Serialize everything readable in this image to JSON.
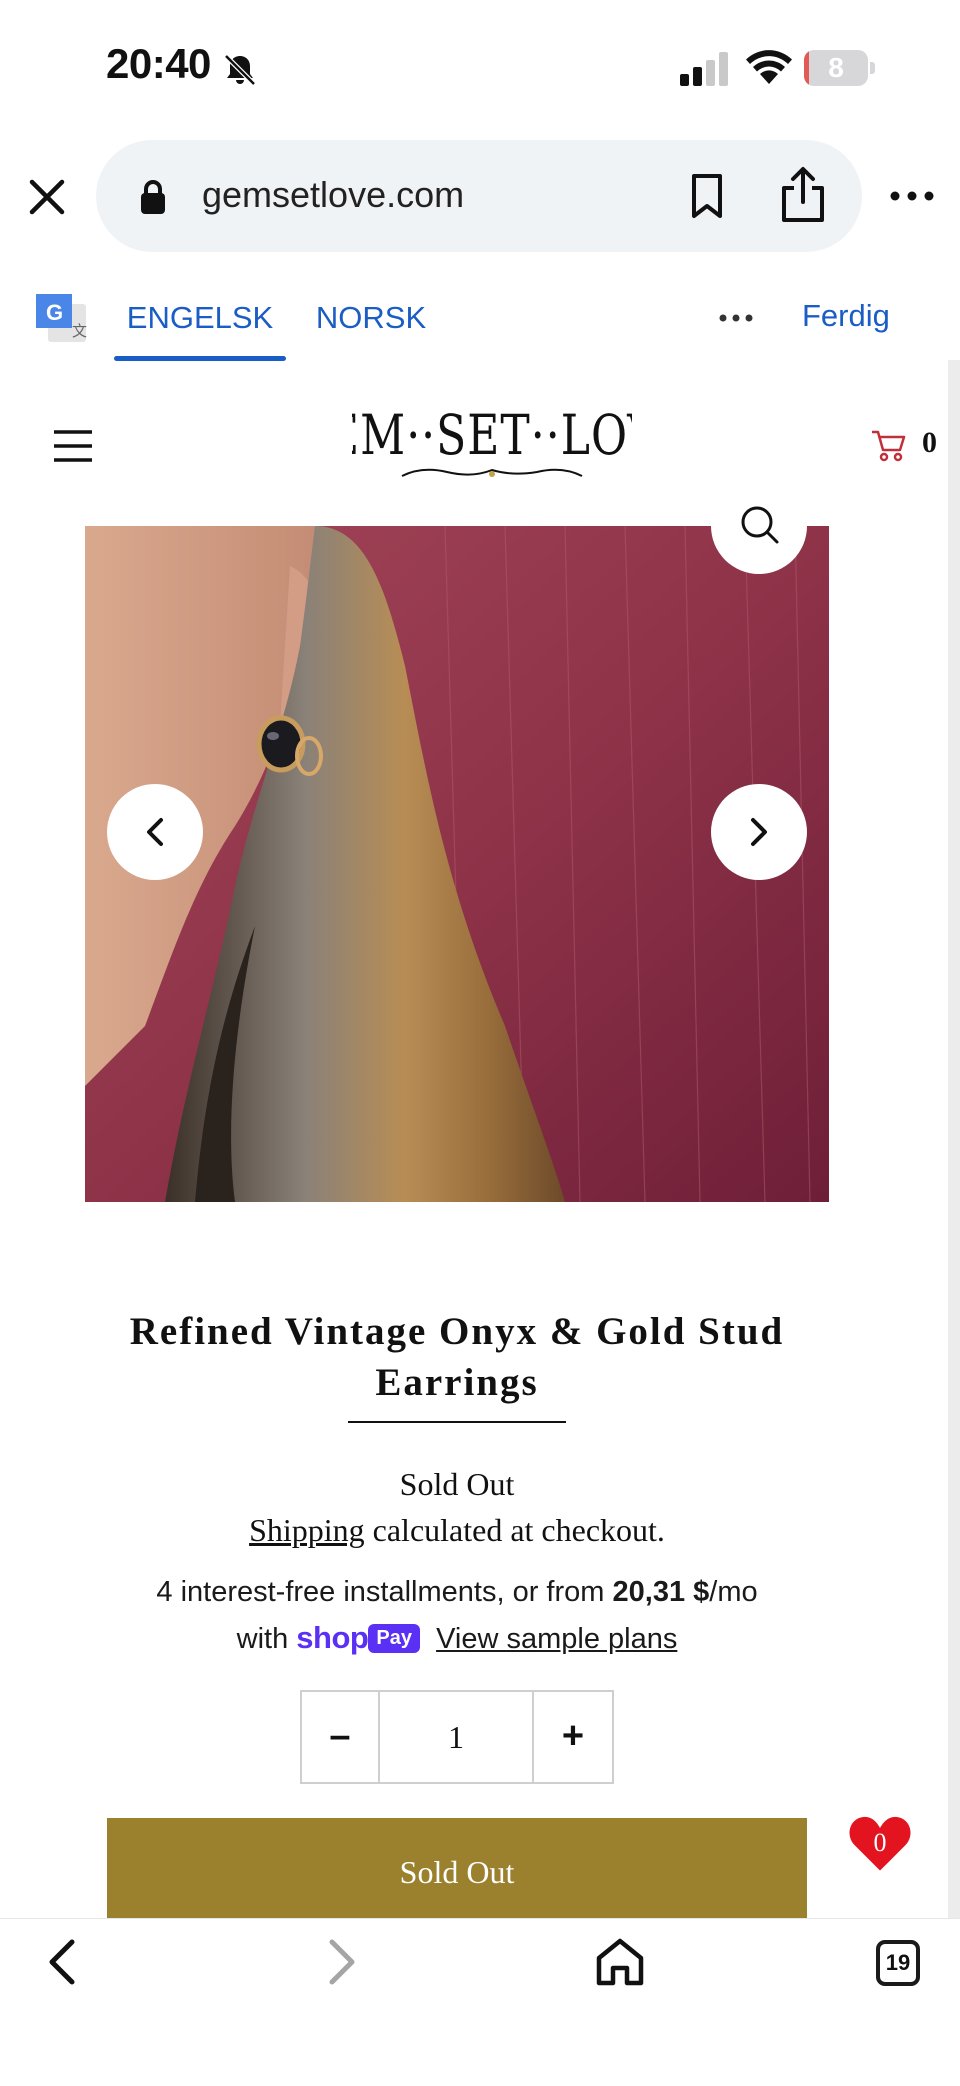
{
  "status_bar": {
    "time": "20:40",
    "battery_level": "8",
    "battery_percent": 8,
    "icons": [
      "bell-off-icon",
      "cellular-signal-icon",
      "wifi-icon",
      "battery-icon"
    ]
  },
  "browser": {
    "url": "gemsetlove.com",
    "icons": [
      "close-icon",
      "lock-icon",
      "bookmark-icon",
      "share-icon",
      "more-icon"
    ]
  },
  "translate_bar": {
    "tabs": [
      {
        "label": "ENGELSK",
        "active": true
      },
      {
        "label": "NORSK",
        "active": false
      }
    ],
    "done_label": "Ferdig",
    "accent": "#1a5dc4"
  },
  "site_header": {
    "logo_text": "GEM·SET·LOVE",
    "cart_count": "0"
  },
  "product": {
    "title": "Refined Vintage Onyx & Gold Stud Earrings",
    "availability": "Sold Out",
    "shipping_link": "Shipping",
    "shipping_rest": " calculated at checkout.",
    "installments_prefix": "4 interest-free installments, or from ",
    "installments_amount": "20,31 $",
    "installments_suffix": "/mo",
    "installments_with": "with",
    "shop_word": "shop",
    "pay_word": "Pay",
    "sample_plans_link": "View sample plans",
    "quantity": "1",
    "qty_minus": "–",
    "qty_plus": "+",
    "button_label": "Sold Out",
    "button_color": "#9b812e"
  },
  "wishlist": {
    "count": "0",
    "color": "#e3141f"
  },
  "bottom_bar": {
    "tabs_count": "19",
    "icons": [
      "back-icon",
      "forward-icon",
      "home-icon",
      "tabs-icon"
    ]
  }
}
